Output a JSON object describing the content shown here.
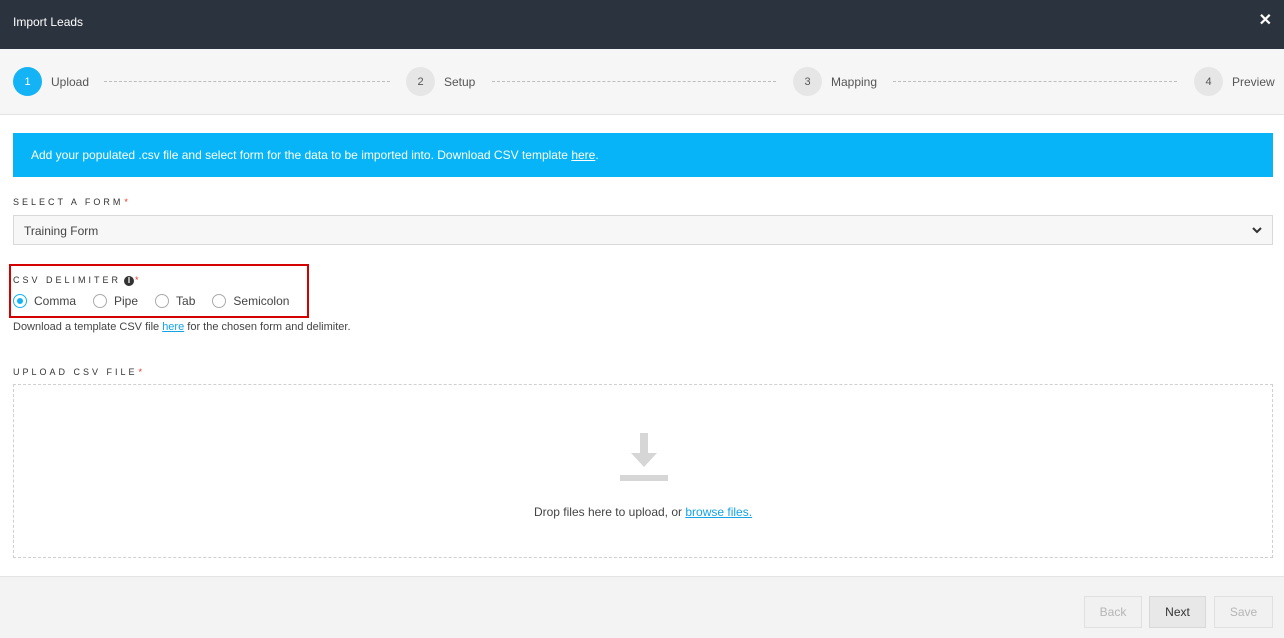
{
  "window": {
    "title": "Import Leads",
    "close_icon": "✕"
  },
  "steps": [
    {
      "num": "1",
      "label": "Upload",
      "active": true
    },
    {
      "num": "2",
      "label": "Setup",
      "active": false
    },
    {
      "num": "3",
      "label": "Mapping",
      "active": false
    },
    {
      "num": "4",
      "label": "Preview",
      "active": false
    }
  ],
  "banner": {
    "text": "Add your populated .csv file and select form for the data to be imported into. Download CSV template ",
    "link": "here",
    "suffix": "."
  },
  "form_select": {
    "label": "SELECT A FORM",
    "required": "*",
    "value": "Training Form"
  },
  "delimiter": {
    "label": "CSV DELIMITER",
    "info_icon": "i",
    "required": "*",
    "options": [
      "Comma",
      "Pipe",
      "Tab",
      "Semicolon"
    ],
    "selected": "Comma"
  },
  "hint": {
    "prefix": "Download a template CSV file ",
    "link": "here",
    "suffix": " for the chosen form and delimiter."
  },
  "upload": {
    "label": "UPLOAD CSV FILE",
    "required": "*",
    "drop_text": "Drop files here to upload, or ",
    "browse_link": "browse files."
  },
  "footer": {
    "back": "Back",
    "next": "Next",
    "save": "Save"
  },
  "colors": {
    "accent": "#13b3f5",
    "banner": "#06b4f7",
    "titlebar": "#2b333e",
    "highlight_box": "#d40000"
  }
}
